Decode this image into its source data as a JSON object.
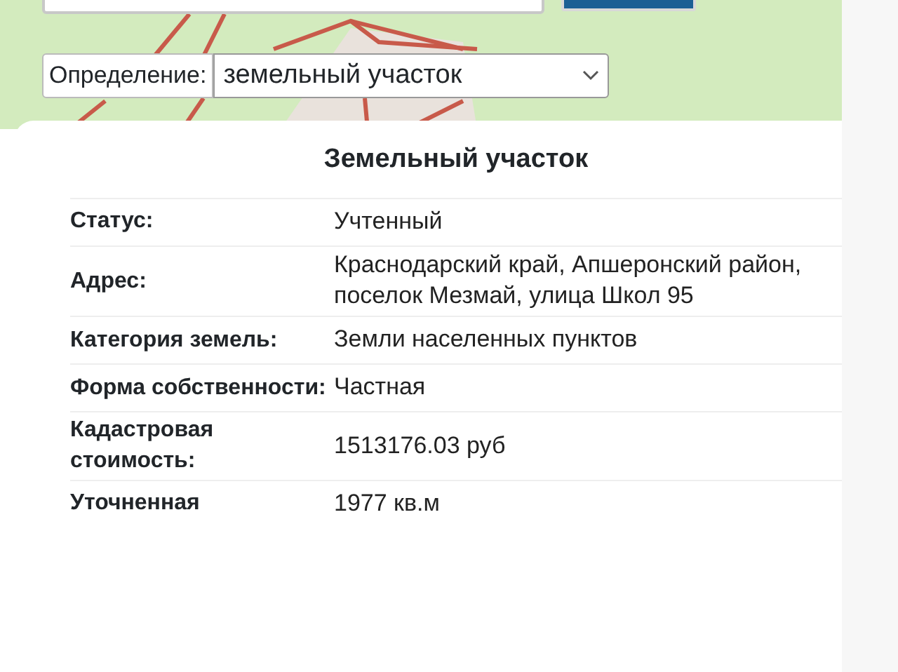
{
  "definition": {
    "label": "Определение:",
    "value": "земельный участок"
  },
  "card": {
    "title": "Земельный участок",
    "rows": [
      {
        "label": "Статус:",
        "value": "Учтенный"
      },
      {
        "label": "Адрес:",
        "value": "Краснодарский край, Апшеронский район, поселок Мезмай, улица Школ 95"
      },
      {
        "label": "Категория земель:",
        "value": "Земли населенных пунктов"
      },
      {
        "label": "Форма собственности:",
        "value": "Частная"
      },
      {
        "label": "Кадастровая стоимость:",
        "value": "1513176.03 руб"
      },
      {
        "label": "Уточненная",
        "value": "1977 кв.м"
      }
    ]
  }
}
